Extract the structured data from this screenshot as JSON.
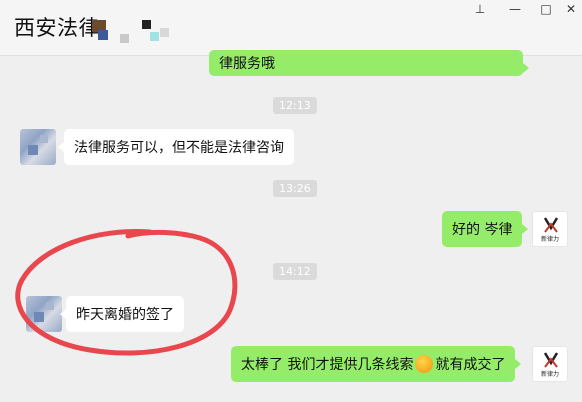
{
  "window": {
    "title": "西安法律",
    "controls": {
      "pin": "⊥",
      "minimize": "—",
      "maximize": "□",
      "close": "✕"
    }
  },
  "messages": [
    {
      "side": "right",
      "text": "律服务哦"
    },
    {
      "type": "time",
      "text": "12:13"
    },
    {
      "side": "left",
      "text": "法律服务可以，但不能是法律咨询"
    },
    {
      "type": "time",
      "text": "13:26"
    },
    {
      "side": "right",
      "text": "好的 岑律"
    },
    {
      "type": "time",
      "text": "14:12"
    },
    {
      "side": "left",
      "text": "昨天离婚的签了"
    },
    {
      "side": "right",
      "text_before": "太棒了 我们才提供几条线索",
      "emoji": "thumbs-up-emoji",
      "text_after": "就有成交了"
    }
  ],
  "avatar_logo_text": "新律力",
  "colors": {
    "outgoing_bubble": "#95ec69",
    "incoming_bubble": "#ffffff",
    "chat_background": "#efefef",
    "annotation_circle": "#e8474e"
  }
}
